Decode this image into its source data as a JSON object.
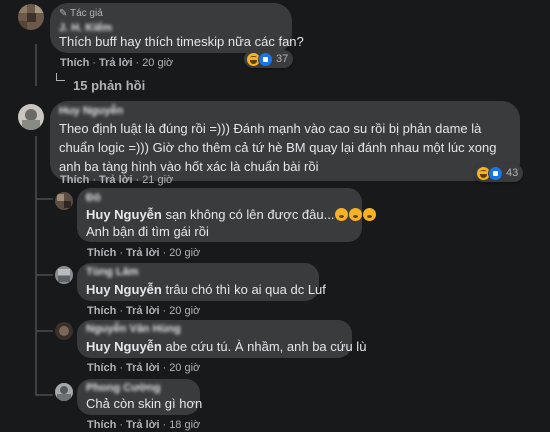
{
  "comments": [
    {
      "author_badge": "✎ Tác giả",
      "author": "J. H. Kiểm",
      "text": "Thích buff hay thích timeskip nữa các fan?",
      "like_label": "Thích",
      "reply_label": "Trả lời",
      "time": "20 giờ",
      "reaction_count": "37",
      "view_replies": "15 phản hồi"
    },
    {
      "author": "Huy Nguyễn",
      "text": "Theo định luật là đúng rồi =))) Đánh mạnh vào cao su rồi bị phản dame là chuẩn logic =))) Giờ cho thêm cả tứ hè BM quay lại đánh nhau một lúc xong anh ba tàng hình vào hốt xác là chuẩn bài rồi",
      "like_label": "Thích",
      "reply_label": "Trả lời",
      "time": "21 giờ",
      "reaction_count": "43"
    }
  ],
  "replies": [
    {
      "author": "Đô",
      "mention": "Huy Nguyễn",
      "text": " sạn không có lên được đâu...",
      "line2": "Anh bận đi tìm gái rồi",
      "like_label": "Thích",
      "reply_label": "Trả lời",
      "time": "20 giờ"
    },
    {
      "author": "Tùng Lâm",
      "mention": "Huy Nguyễn",
      "text": " trâu chó thì ko ai qua dc Luf",
      "like_label": "Thích",
      "reply_label": "Trả lời",
      "time": "20 giờ"
    },
    {
      "author": "Nguyễn Văn Hùng",
      "mention": "Huy Nguyễn",
      "text": " abe cứu tú. À nhầm, anh ba cứu lù",
      "like_label": "Thích",
      "reply_label": "Trả lời",
      "time": "20 giờ"
    },
    {
      "author": "Phong Cường",
      "text": "Chả còn skin gì hơn",
      "like_label": "Thích",
      "reply_label": "Trả lời",
      "time": "18 giờ"
    }
  ],
  "colors": {
    "background": "#18191a",
    "bubble": "#3a3b3c",
    "text": "#e4e6eb",
    "meta": "#b0b3b8",
    "haha": "#f7b125",
    "like": "#1b74e4"
  }
}
